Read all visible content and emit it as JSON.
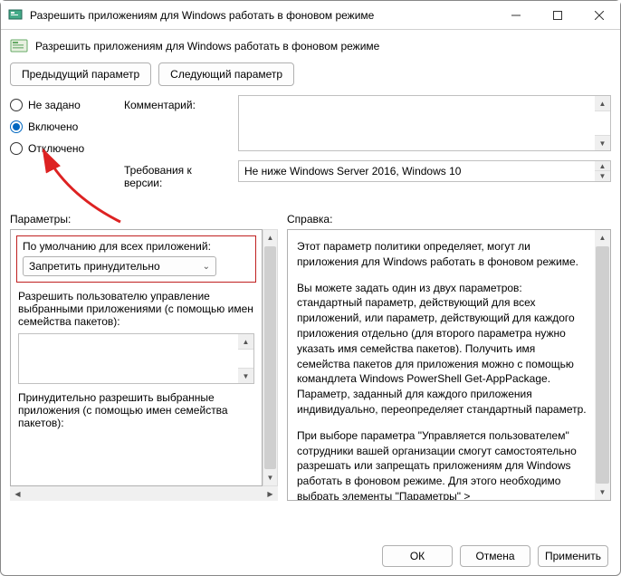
{
  "window": {
    "title": "Разрешить приложениям для Windows работать в фоновом режиме"
  },
  "header": {
    "label": "Разрешить приложениям для Windows работать в фоновом режиме"
  },
  "nav": {
    "prev": "Предыдущий параметр",
    "next": "Следующий параметр"
  },
  "state": {
    "not_configured": "Не задано",
    "enabled": "Включено",
    "disabled": "Отключено",
    "selected": "enabled"
  },
  "labels": {
    "comment": "Комментарий:",
    "requirements": "Требования к версии:",
    "parameters": "Параметры:",
    "help": "Справка:"
  },
  "requirements_value": "Не ниже Windows Server 2016, Windows 10",
  "options": {
    "default_label": "По умолчанию для всех приложений:",
    "default_value": "Запретить принудительно",
    "user_control_label": "Разрешить пользователю управление выбранными приложениями (с помощью имен семейства пакетов):",
    "force_allow_label": "Принудительно разрешить выбранные приложения (с помощью имен семейства пакетов):"
  },
  "help_text": {
    "p1": "Этот параметр политики определяет, могут ли приложения для Windows работать в фоновом режиме.",
    "p2": "Вы можете задать один из двух параметров: стандартный параметр, действующий для всех приложений, или параметр, действующий для каждого приложения отдельно (для второго параметра нужно указать имя семейства пакетов). Получить имя семейства пакетов для приложения можно с помощью командлета Windows PowerShell Get-AppPackage. Параметр, заданный для каждого приложения индивидуально, переопределяет стандартный параметр.",
    "p3": "При выборе параметра \"Управляется пользователем\" сотрудники вашей организации смогут самостоятельно разрешать или запрещать приложениям для Windows работать в фоновом режиме. Для этого необходимо выбрать элементы \"Параметры\" > \"Конфиденциальность\" на устройстве."
  },
  "footer": {
    "ok": "ОК",
    "cancel": "Отмена",
    "apply": "Применить"
  }
}
